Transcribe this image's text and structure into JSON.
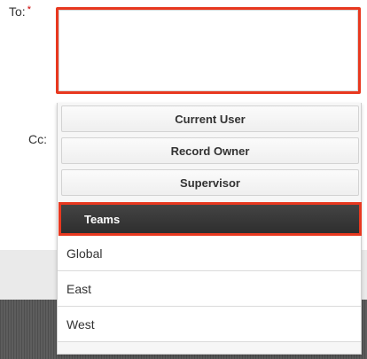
{
  "form": {
    "to_label": "To:",
    "required_marker": "*",
    "to_value": "",
    "cc_label": "Cc:"
  },
  "dropdown": {
    "options": [
      {
        "label": "Current User"
      },
      {
        "label": "Record Owner"
      },
      {
        "label": "Supervisor"
      }
    ],
    "teams_header": "Teams",
    "teams": [
      {
        "label": "Global"
      },
      {
        "label": "East"
      },
      {
        "label": "West"
      }
    ]
  },
  "colors": {
    "highlight": "#e8381f",
    "required": "#cc0000",
    "teams_header_bg": "#3a3a3a"
  }
}
